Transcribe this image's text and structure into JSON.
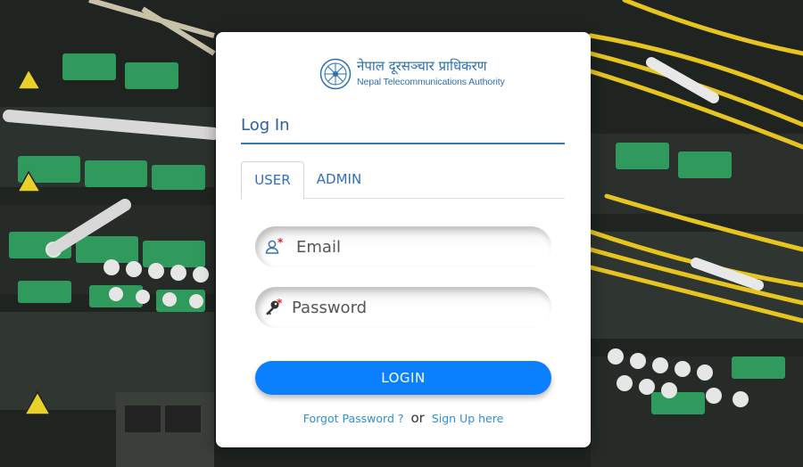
{
  "brand": {
    "name_nepali": "नेपाल दूरसञ्चार प्राधिकरण",
    "name_english": "Nepal Telecommunications Authority",
    "color": "#2b6fb0"
  },
  "login": {
    "heading": "Log In",
    "tabs": [
      {
        "label": "USER",
        "active": true
      },
      {
        "label": "ADMIN",
        "active": false
      }
    ],
    "email_field": {
      "placeholder": "Email",
      "value": "",
      "icon": "user-icon",
      "required_marker": "*"
    },
    "password_field": {
      "placeholder": "Password",
      "value": "",
      "icon": "key-icon",
      "required_marker": "*"
    },
    "submit_label": "LOGIN",
    "forgot_password_label": "Forgot Password ?",
    "or_label": "or",
    "signup_label": "Sign Up here"
  },
  "colors": {
    "accent": "#0a80ff",
    "link": "#2b8fd6",
    "heading": "#2e5f9e",
    "required": "#d9232e"
  }
}
